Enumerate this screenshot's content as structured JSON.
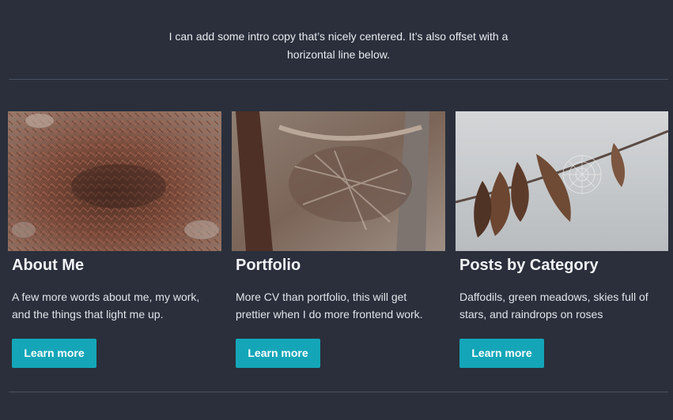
{
  "intro": {
    "text": "I can add some intro copy that’s nicely centered. It’s also offset with a horizontal line below."
  },
  "cards": [
    {
      "title": "About Me",
      "text": "A few more words about me, my work, and the things that light me up.",
      "button": "Learn more"
    },
    {
      "title": "Portfolio",
      "text": "More CV than portfolio, this will get prettier when I do more frontend work.",
      "button": "Learn more"
    },
    {
      "title": "Posts by Category",
      "text": "Daffodils, green meadows, skies full of stars, and raindrops on roses",
      "button": "Learn more"
    }
  ],
  "colors": {
    "background": "#2a2f3b",
    "accent": "#14a6b8",
    "divider": "#4a5060"
  }
}
